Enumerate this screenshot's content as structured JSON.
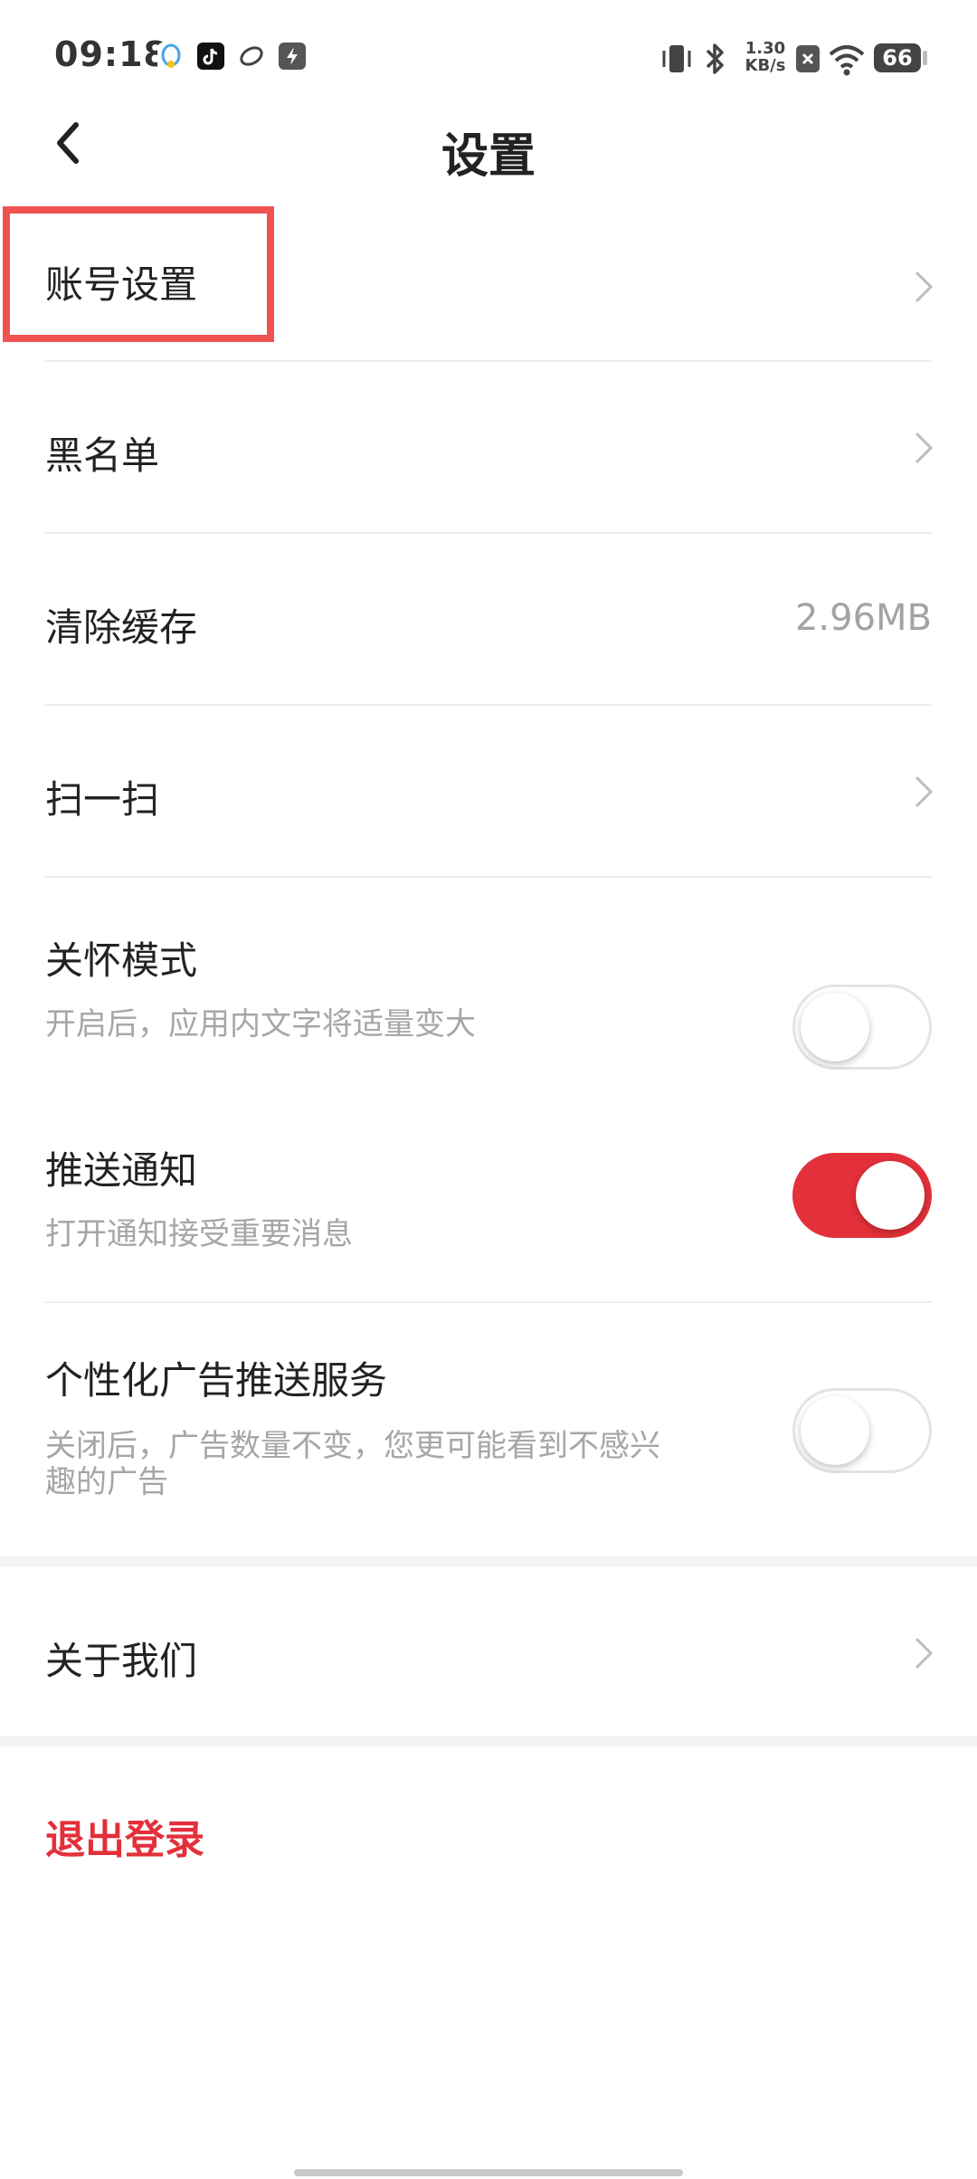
{
  "status": {
    "time": "09:18",
    "net_speed_value": "1.30",
    "net_speed_unit": "KB/s",
    "battery": "66"
  },
  "header": {
    "title": "设置"
  },
  "settings": {
    "account": {
      "label": "账号设置"
    },
    "blacklist": {
      "label": "黑名单"
    },
    "clear_cache": {
      "label": "清除缓存",
      "value": "2.96MB"
    },
    "scan": {
      "label": "扫一扫"
    },
    "care_mode": {
      "label": "关怀模式",
      "desc": "开启后，应用内文字将适量变大",
      "enabled": false
    },
    "push": {
      "label": "推送通知",
      "desc": "打开通知接受重要消息",
      "enabled": true
    },
    "ads": {
      "label": "个性化广告推送服务",
      "desc_line1": "关闭后，广告数量不变，您更可能看到不感兴",
      "desc_line2": "趣的广告",
      "enabled": false
    },
    "about": {
      "label": "关于我们"
    }
  },
  "logout": {
    "label": "退出登录"
  },
  "colors": {
    "accent": "#e3303a",
    "highlight": "#ef5350"
  }
}
